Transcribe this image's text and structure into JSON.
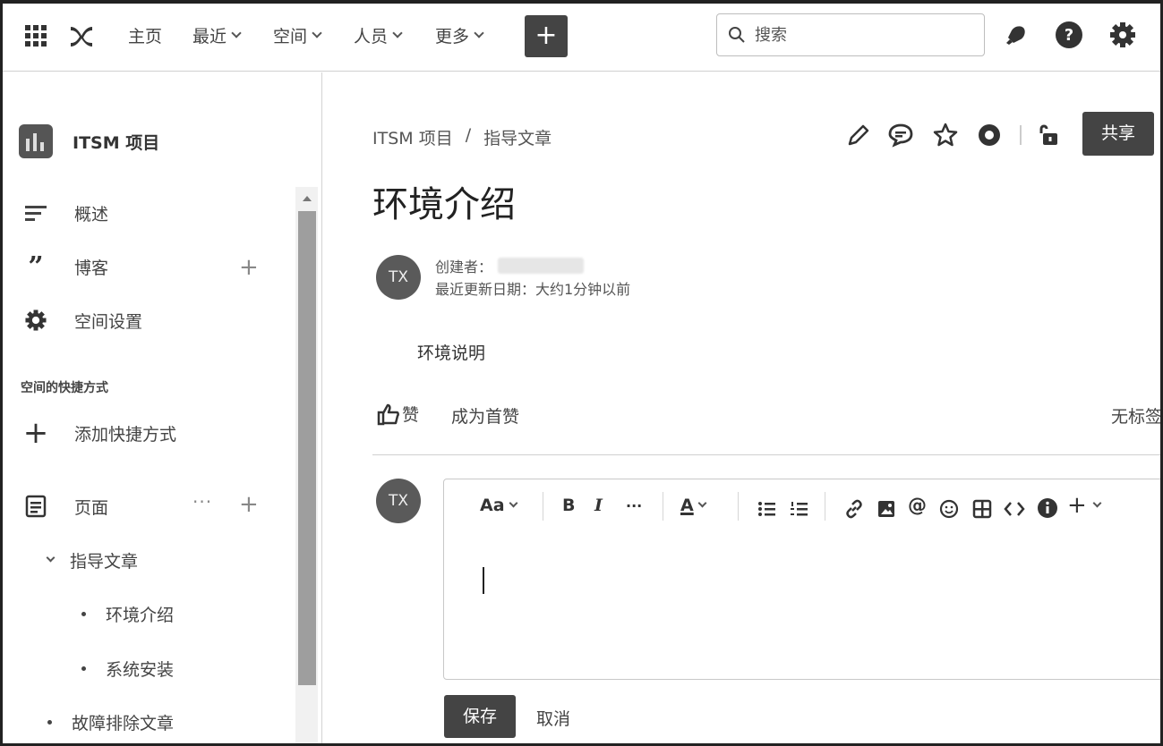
{
  "topbar": {
    "home": "主页",
    "recent": "最近",
    "spaces": "空间",
    "people": "人员",
    "more": "更多",
    "create_symbol": "+",
    "search_placeholder": "搜索"
  },
  "sidebar": {
    "space_name": "ITSM 项目",
    "overview": "概述",
    "blog": "博客",
    "space_settings": "空间设置",
    "shortcuts_section": "空间的快捷方式",
    "add_shortcut": "添加快捷方式",
    "pages": "页面",
    "page_tree": {
      "parent": "指导文章",
      "children": [
        "环境介绍",
        "系统安装"
      ],
      "sibling": "故障排除文章"
    }
  },
  "main": {
    "breadcrumb": [
      "ITSM 项目",
      "/",
      "指导文章"
    ],
    "share_label": "共享",
    "title": "环境介绍",
    "author_initials": "TX",
    "created_by_label": "创建者：",
    "last_updated": "最近更新日期：大约1分钟以前",
    "body_text": "环境说明",
    "like_label": "赞",
    "be_first_like": "成为首赞",
    "no_label": "无标签"
  },
  "comment_editor": {
    "avatar_initials": "TX",
    "toolbar": {
      "text_style": "Aa",
      "bold": "B",
      "italic": "I",
      "more": "···",
      "text_color": "A",
      "insert": "+"
    },
    "save_label": "保存",
    "cancel_label": "取消"
  }
}
